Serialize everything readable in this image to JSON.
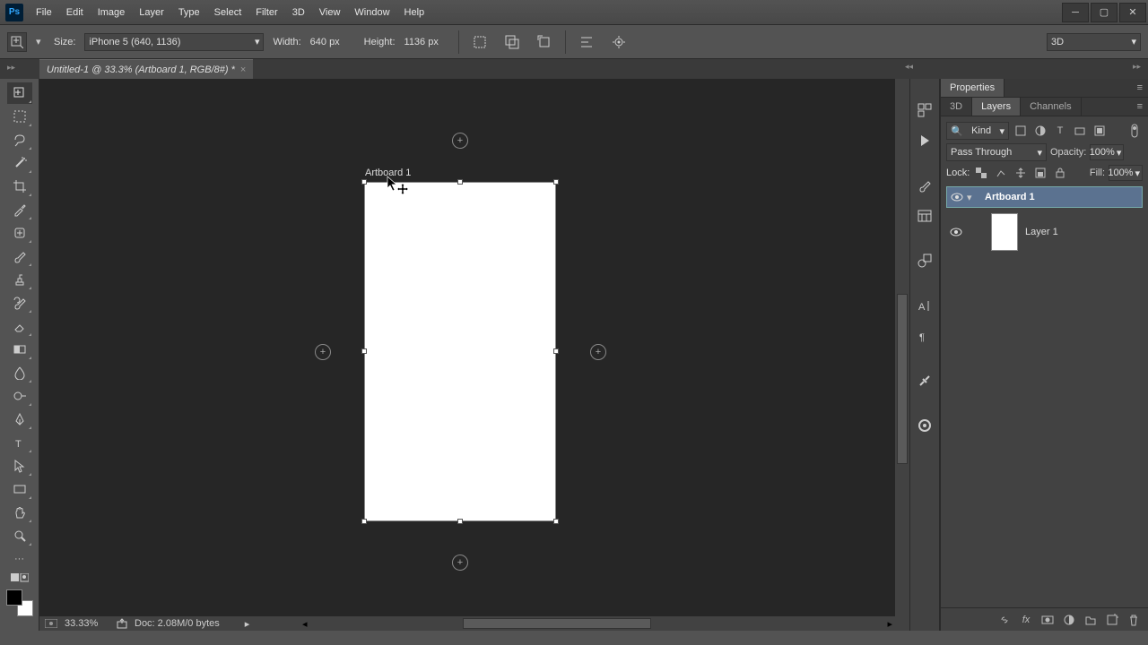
{
  "menu": [
    "File",
    "Edit",
    "Image",
    "Layer",
    "Type",
    "Select",
    "Filter",
    "3D",
    "View",
    "Window",
    "Help"
  ],
  "options": {
    "size_label": "Size:",
    "size_value": "iPhone 5 (640, 1136)",
    "width_label": "Width:",
    "width_value": "640 px",
    "height_label": "Height:",
    "height_value": "1136 px"
  },
  "workspace": "3D",
  "doctab": {
    "title": "Untitled-1 @ 33.3% (Artboard 1, RGB/8#) *"
  },
  "artboard": {
    "label": "Artboard 1"
  },
  "status": {
    "zoom": "33.33%",
    "doc_info": "Doc: 2.08M/0 bytes"
  },
  "panels": {
    "props_tab": "Properties",
    "tabs": [
      "3D",
      "Layers",
      "Channels"
    ],
    "active_tab": "Layers",
    "kind_label": "Kind",
    "blend_mode": "Pass Through",
    "opacity_label": "Opacity:",
    "opacity_value": "100%",
    "lock_label": "Lock:",
    "fill_label": "Fill:",
    "fill_value": "100%",
    "artboard_name": "Artboard 1",
    "layer_name": "Layer 1"
  }
}
